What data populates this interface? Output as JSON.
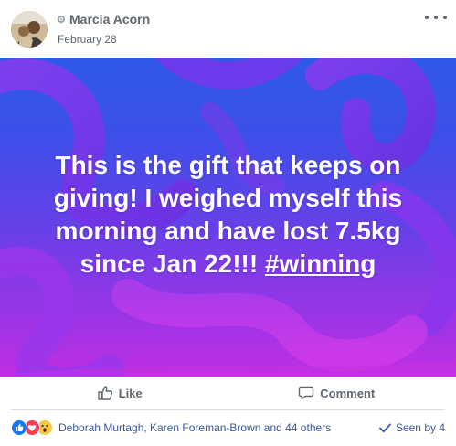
{
  "post": {
    "author": "Marcia Acorn",
    "date": "February 28",
    "text_lines": [
      "This is the gift that keeps on",
      "giving! I weighed myself this",
      "morning and have lost 7.5kg",
      "since Jan 22!!! "
    ],
    "hashtag": "#winning"
  },
  "actions": {
    "like_label": "Like",
    "comment_label": "Comment"
  },
  "reactions": {
    "icons": [
      "like-icon",
      "love-icon",
      "wow-icon"
    ],
    "names": "Deborah Murtagh, Karen Foreman-Brown and 44 others",
    "seen_by": "Seen by 4"
  },
  "colors": {
    "link": "#385898",
    "secondary_text": "#616770",
    "like_blue": "#1877f2",
    "love_red": "#f33e58",
    "wow_yellow": "#f7c843",
    "image_gradient_top": "#2f59e6",
    "image_gradient_bottom": "#c02fe2"
  }
}
